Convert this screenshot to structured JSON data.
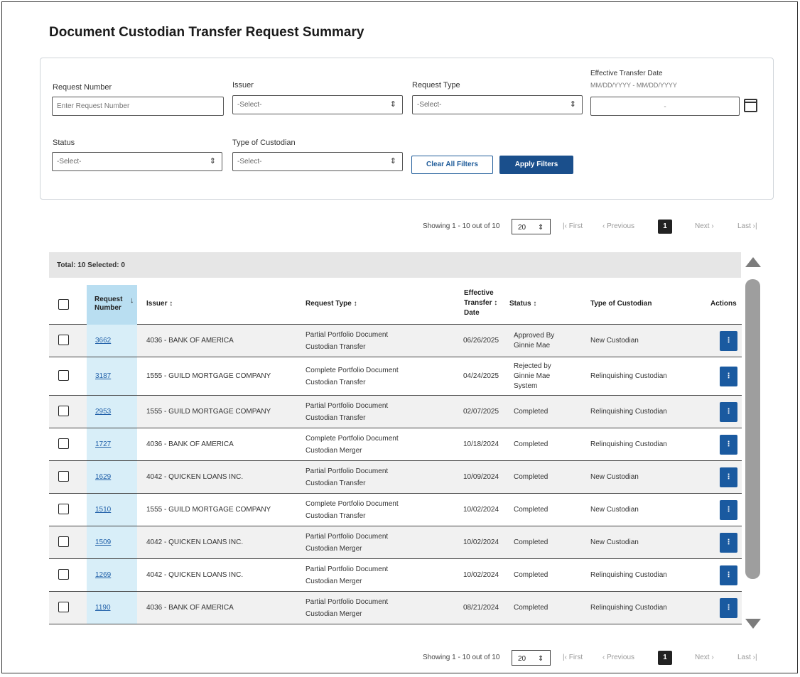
{
  "page": {
    "title": "Document Custodian Transfer Request Summary"
  },
  "filters": {
    "request_number": {
      "label": "Request Number",
      "placeholder": "Enter Request Number"
    },
    "issuer": {
      "label": "Issuer",
      "value": "-Select-"
    },
    "request_type": {
      "label": "Request Type",
      "value": "-Select-"
    },
    "effective_date": {
      "label": "Effective Transfer Date",
      "hint": "MM/DD/YYYY - MM/DD/YYYY",
      "value": "-"
    },
    "status": {
      "label": "Status",
      "value": "-Select-"
    },
    "custodian_type": {
      "label": "Type of Custodian",
      "value": "-Select-"
    },
    "clear_label": "Clear All Filters",
    "apply_label": "Apply Filters"
  },
  "pager": {
    "showing": "Showing 1 - 10 out of 10",
    "page_size": "20",
    "first": "|‹ First",
    "prev": "‹ Previous",
    "current": "1",
    "next": "Next ›",
    "last": "Last ›|"
  },
  "table": {
    "summary": "Total: 10  Selected: 0",
    "headers": {
      "request_number": "Request\nNumber",
      "issuer": "Issuer ↕",
      "request_type": "Request Type ↕",
      "effective_date_l1": "Effective",
      "effective_date_l2": "Transfer  ↕",
      "effective_date_l3": "Date",
      "status": "Status ↕",
      "custodian": "Type of Custodian",
      "actions": "Actions"
    },
    "rows": [
      {
        "num": "3662",
        "issuer": "4036 - BANK OF AMERICA",
        "type1": "Partial Portfolio Document",
        "type2": "Custodian Transfer",
        "date": "06/26/2025",
        "status": "Approved By\nGinnie Mae",
        "custodian": "New Custodian",
        "action": "⋮"
      },
      {
        "num": "3187",
        "issuer": "1555 - GUILD MORTGAGE COMPANY",
        "type1": "Complete Portfolio Document",
        "type2": "Custodian Transfer",
        "date": "04/24/2025",
        "status": "Rejected by\nGinnie Mae\nSystem",
        "custodian": "Relinquishing Custodian",
        "action": "⋮"
      },
      {
        "num": "2953",
        "issuer": "1555 - GUILD MORTGAGE COMPANY",
        "type1": "Partial Portfolio Document",
        "type2": "Custodian Transfer",
        "date": "02/07/2025",
        "status": "Completed",
        "custodian": "Relinquishing Custodian",
        "action": "⋮"
      },
      {
        "num": "1727",
        "issuer": "4036 - BANK OF AMERICA",
        "type1": "Complete Portfolio Document",
        "type2": "Custodian Merger",
        "date": "10/18/2024",
        "status": "Completed",
        "custodian": "Relinquishing Custodian",
        "action": "⋮"
      },
      {
        "num": "1629",
        "issuer": "4042 - QUICKEN LOANS INC.",
        "type1": "Partial Portfolio Document",
        "type2": "Custodian Transfer",
        "date": "10/09/2024",
        "status": "Completed",
        "custodian": "New Custodian",
        "action": "⋮"
      },
      {
        "num": "1510",
        "issuer": "1555 - GUILD MORTGAGE COMPANY",
        "type1": "Complete Portfolio Document",
        "type2": "Custodian Transfer",
        "date": "10/02/2024",
        "status": "Completed",
        "custodian": "New Custodian",
        "action": "⋮"
      },
      {
        "num": "1509",
        "issuer": "4042 - QUICKEN LOANS INC.",
        "type1": "Partial Portfolio Document",
        "type2": "Custodian Merger",
        "date": "10/02/2024",
        "status": "Completed",
        "custodian": "New Custodian",
        "action": "⋮"
      },
      {
        "num": "1269",
        "issuer": "4042 - QUICKEN LOANS INC.",
        "type1": "Partial Portfolio Document",
        "type2": "Custodian Merger",
        "date": "10/02/2024",
        "status": "Completed",
        "custodian": "Relinquishing Custodian",
        "action": "⋮"
      },
      {
        "num": "1190",
        "issuer": "4036 - BANK OF AMERICA",
        "type1": "Partial Portfolio Document",
        "type2": "Custodian Merger",
        "date": "08/21/2024",
        "status": "Completed",
        "custodian": "Relinquishing Custodian",
        "action": "⋮"
      }
    ]
  }
}
